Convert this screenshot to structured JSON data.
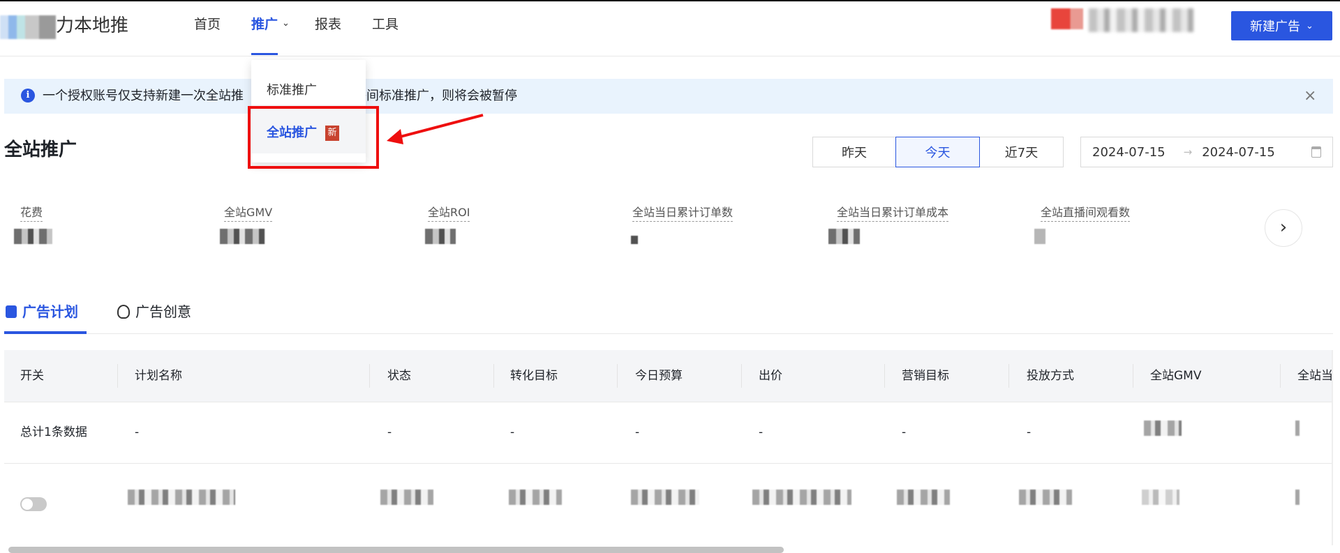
{
  "header": {
    "brand": "力本地推",
    "nav": [
      {
        "label": "首页",
        "active": false
      },
      {
        "label": "推广",
        "active": true,
        "has_dropdown": true
      },
      {
        "label": "报表",
        "active": false
      },
      {
        "label": "工具",
        "active": false
      }
    ],
    "new_ad_button": "新建广告",
    "accent": "#2a56e0"
  },
  "dropdown": {
    "items": [
      {
        "label": "标准推广"
      },
      {
        "label": "全站推广",
        "badge": "新",
        "highlighted": true
      }
    ]
  },
  "alert": {
    "text_left": "一个授权账号仅支持新建一次全站推",
    "text_right": "有直播间标准推广，则将会被暂停",
    "close": "×"
  },
  "page": {
    "title": "全站推广",
    "date_ranges": [
      {
        "label": "昨天",
        "selected": false
      },
      {
        "label": "今天",
        "selected": true
      },
      {
        "label": "近7天",
        "selected": false
      }
    ],
    "date_start": "2024-07-15",
    "date_sep": "→",
    "date_end": "2024-07-15"
  },
  "metrics": [
    {
      "label": "花费"
    },
    {
      "label": "全站GMV"
    },
    {
      "label": "全站ROI"
    },
    {
      "label": "全站当日累计订单数"
    },
    {
      "label": "全站当日累计订单成本"
    },
    {
      "label": "全站直播间观看数"
    }
  ],
  "tabs": [
    {
      "label": "广告计划",
      "active": true
    },
    {
      "label": "广告创意",
      "active": false
    }
  ],
  "table": {
    "columns": [
      "开关",
      "计划名称",
      "状态",
      "转化目标",
      "今日预算",
      "出价",
      "营销目标",
      "投放方式",
      "全站GMV",
      "全站当"
    ],
    "summary_row": [
      "总计1条数据",
      "-",
      "-",
      "-",
      "-",
      "-",
      "-",
      "-"
    ]
  }
}
